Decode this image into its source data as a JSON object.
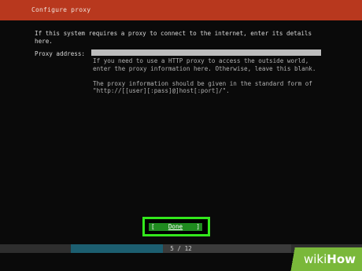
{
  "header": {
    "title": "Configure proxy"
  },
  "intro": {
    "text": "If this system requires a proxy to connect to the internet, enter its details\nhere."
  },
  "proxy": {
    "label": "Proxy address:",
    "value": "",
    "placeholder": ""
  },
  "help": {
    "para1": "If you need to use a HTTP proxy to access the outside world,\nenter the proxy information here. Otherwise, leave this blank.",
    "para2": "The proxy information should be given in the standard form of\n\"http://[[user][:pass]@]host[:port]/\"."
  },
  "done_button": {
    "open": "[",
    "label": "Done",
    "close": "]"
  },
  "progress": {
    "current": 5,
    "total": 12,
    "text": "5 / 12",
    "fraction": 0.4167
  },
  "watermark": {
    "wiki": "wiki",
    "how": "How"
  },
  "colors": {
    "header_bg": "#b8381e",
    "background": "#0a0a0a",
    "highlight": "#33e81c",
    "button_bg": "#1f8a1f",
    "progress_fill": "#1c5e70"
  }
}
